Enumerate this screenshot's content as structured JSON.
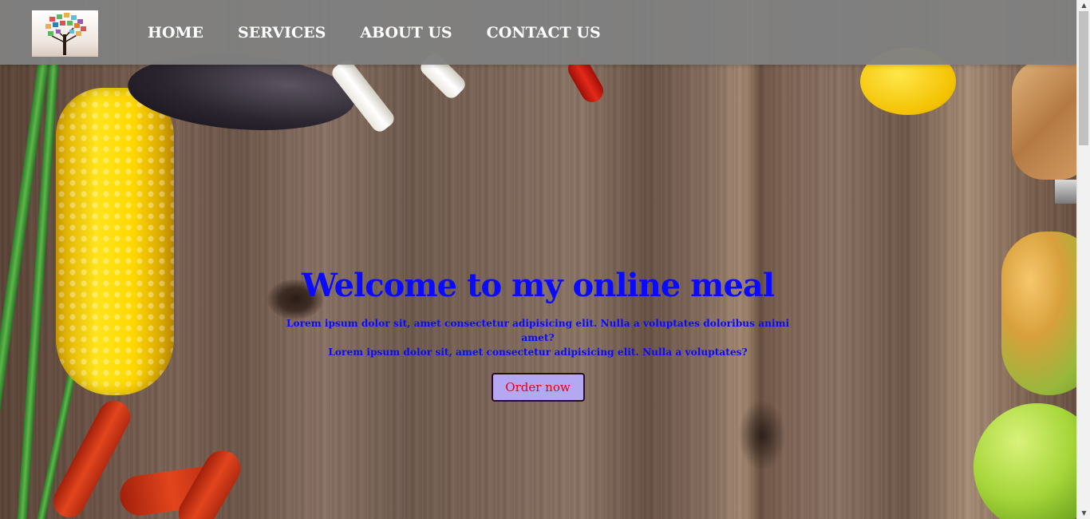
{
  "navbar": {
    "logo_alt": "tree-logo",
    "links": [
      {
        "label": "HOME"
      },
      {
        "label": "SERVICES"
      },
      {
        "label": "ABOUT US"
      },
      {
        "label": "CONTACT US"
      }
    ]
  },
  "hero": {
    "title": "Welcome to my online meal",
    "line1": "Lorem ipsum dolor sit, amet consectetur adipisicing elit. Nulla a voluptates doloribus animi amet?",
    "line2": "Lorem ipsum dolor sit, amet consectetur adipisicing elit. Nulla a voluptates?",
    "button_label": "Order now"
  },
  "colors": {
    "navbar": "#808080",
    "title": "#0a0aff",
    "button_bg": "#b3a8f1",
    "button_text": "#e8000f"
  },
  "scrollbar": {
    "up_icon": "scroll-up-arrow-icon",
    "down_icon": "scroll-down-arrow-icon"
  }
}
